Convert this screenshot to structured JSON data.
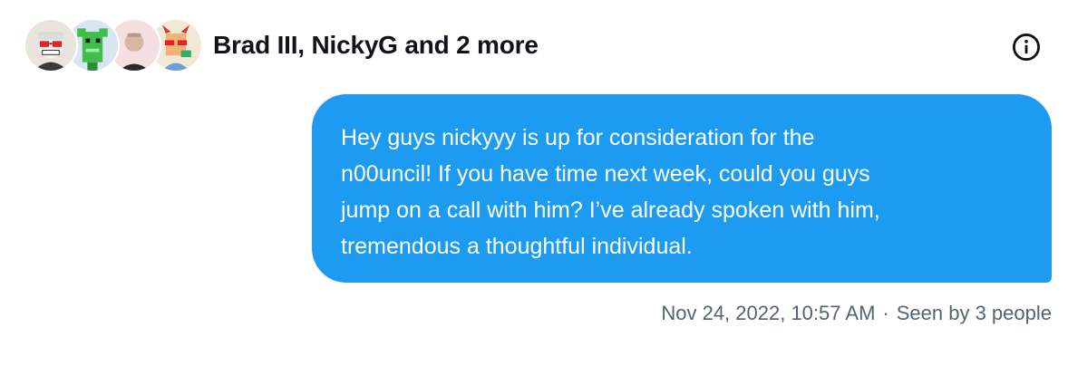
{
  "conversation": {
    "title": "Brad III, NickyG and 2 more",
    "avatars": [
      {
        "icon": "cat-avatar-red-glasses-icon",
        "bg": "#e9e4dc"
      },
      {
        "icon": "green-frog-avatar-icon",
        "bg": "#d9e6f2"
      },
      {
        "icon": "bearded-man-avatar-icon",
        "bg": "#f6dfe3"
      },
      {
        "icon": "devil-avatar-red-glasses-icon",
        "bg": "#f2e8d6"
      }
    ],
    "info_icon": "info-icon"
  },
  "message": {
    "lines": [
      "Hey guys nickyyy is up for consideration for the",
      "n00uncil! If you have time next week, could you guys",
      "jump on a call with him? I’ve already spoken with him,",
      "tremendous a thoughtful individual."
    ],
    "timestamp": "Nov 24, 2022, 10:57 AM",
    "separator": "·",
    "seen": "Seen by 3 people"
  },
  "colors": {
    "bubble": "#1d9bf0",
    "text": "#0f1419",
    "meta": "#536471"
  }
}
